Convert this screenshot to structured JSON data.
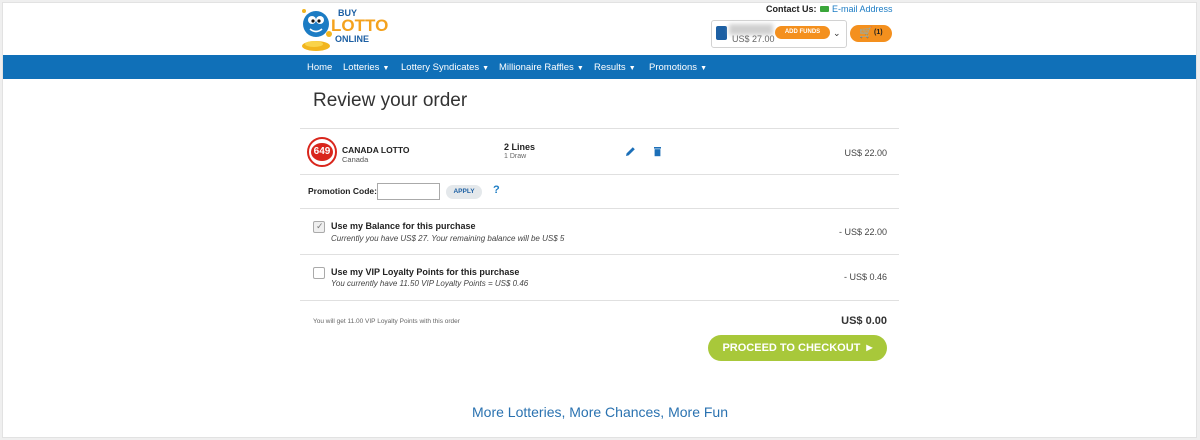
{
  "header": {
    "logo_lines": [
      "BUY",
      "LOTTO",
      "ONLINE"
    ],
    "contact_label": "Contact Us:",
    "email_link": "E-mail Address",
    "account_balance": "US$ 27.00",
    "add_funds_label": "ADD FUNDS",
    "cart_count": "(1)",
    "icon_names": [
      "mascot-logo",
      "mail-icon",
      "avatar-icon",
      "chevron-down-icon",
      "cart-icon"
    ],
    "brand_colors": {
      "nav": "#1070b8",
      "accent": "#f4901e",
      "checkout": "#a8c83a"
    }
  },
  "nav": {
    "items": [
      {
        "label": "Home",
        "dropdown": false
      },
      {
        "label": "Lotteries",
        "dropdown": true
      },
      {
        "label": "Lottery Syndicates",
        "dropdown": true
      },
      {
        "label": "Millionaire Raffles",
        "dropdown": true
      },
      {
        "label": "Results",
        "dropdown": true
      },
      {
        "label": "Promotions",
        "dropdown": true
      }
    ]
  },
  "main": {
    "title": "Review your order",
    "order_item": {
      "logo_text": "649",
      "name": "CANADA LOTTO",
      "country": "Canada",
      "lines": "2 Lines",
      "draws": "1 Draw",
      "price": "US$ 22.00"
    },
    "promo": {
      "label": "Promotion Code:",
      "value": "",
      "placeholder": "",
      "apply_label": "APPLY",
      "help_label": "?"
    },
    "balance_option": {
      "checked": true,
      "title": "Use my Balance for this purchase",
      "subtitle": "Currently you have US$ 27. Your remaining balance will be US$ 5",
      "amount": "- US$ 22.00"
    },
    "vip_option": {
      "checked": false,
      "title": "Use my VIP Loyalty Points for this purchase",
      "subtitle": "You currently have 11.50 VIP Loyalty Points = US$ 0.46",
      "amount": "- US$ 0.46"
    },
    "loyalty_note": "You will get 11.00 VIP Loyalty Points with this order",
    "total": "US$ 0.00",
    "checkout_label": "PROCEED TO CHECKOUT"
  },
  "footer": {
    "tagline": "More Lotteries, More Chances, More Fun"
  }
}
